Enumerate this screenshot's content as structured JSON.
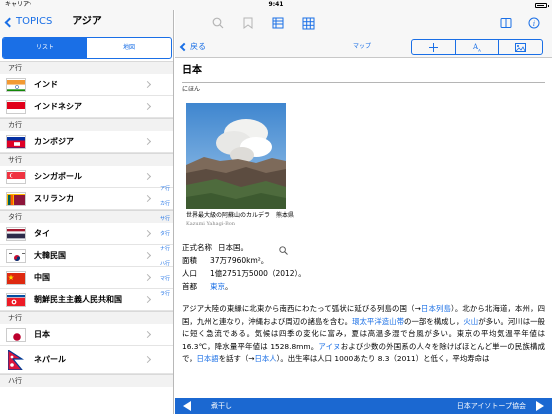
{
  "status": {
    "carrier": "キャリア",
    "time": "9:41"
  },
  "left": {
    "back_label": "TOPICS",
    "title": "アジア",
    "segments": [
      "リスト",
      "地図"
    ],
    "sections": [
      {
        "header": "ア行",
        "items": [
          "インド",
          "インドネシア"
        ]
      },
      {
        "header": "カ行",
        "items": [
          "カンボジア"
        ]
      },
      {
        "header": "サ行",
        "items": [
          "シンガポール",
          "スリランカ"
        ]
      },
      {
        "header": "タ行",
        "items": [
          "タイ",
          "大韓民国",
          "中国",
          "朝鮮民主主義人民共和国"
        ]
      },
      {
        "header": "ナ行",
        "items": [
          "日本",
          "ネパール"
        ]
      },
      {
        "header": "ハ行",
        "items": []
      }
    ],
    "index": [
      "ア行",
      "カ行",
      "サ行",
      "タ行",
      "ナ行",
      "ハ行",
      "マ行",
      "ラ行"
    ]
  },
  "toolbar": {
    "icons": [
      "search-icon",
      "bookmark-icon",
      "list-icon",
      "grid-icon",
      "split-view-icon",
      "info-icon"
    ]
  },
  "nav": {
    "back_label": "戻る",
    "map_label": "マップ",
    "segment_icons": [
      "add-icon",
      "font-size-icon",
      "image-icon"
    ]
  },
  "article": {
    "title": "日本",
    "reading": "にほん",
    "caption": "世界最大級の阿蘇山のカルデラ　熊本県",
    "credit": "Kazumi Yahagi-Bon",
    "facts": [
      {
        "key": "正式名称",
        "value": "日本国。"
      },
      {
        "key": "面積",
        "value": "37万7960km²。"
      },
      {
        "key": "人口",
        "value": "1億2751万5000（2012）。"
      },
      {
        "key": "首都",
        "value": "。",
        "link": "東京"
      }
    ],
    "para": {
      "t1": "アジア大陸の東縁に北東から南西にわたって弧状に延びる列島の国（→",
      "l1": "日本列島",
      "t2": "）。北から北海道，本州，四国，九州と連なり，沖縄および周辺の諸島を含む。",
      "l2": "環太平洋造山帯",
      "t3": "の一部を構成し，",
      "l3": "火山",
      "t4": "が多い。河川は一般に短く急流である。気候は四季の変化に富み，夏は高温多湿で台風が多い。東京の平均気温平年値は 16.3℃，降水量平年値は 1528.8mm。",
      "l4": "アイヌ",
      "t5": "および少数の外国系の人々を除けばほとんど単一の民族構成で，",
      "l5": "日本語",
      "t6": "を話す（→",
      "l6": "日本人",
      "t7": "）。出生率は人口 1000あたり 8.3（2011）と低く，平均寿命は"
    }
  },
  "footer": {
    "label": "煮干し",
    "publisher": "日本アイソトープ協会"
  }
}
